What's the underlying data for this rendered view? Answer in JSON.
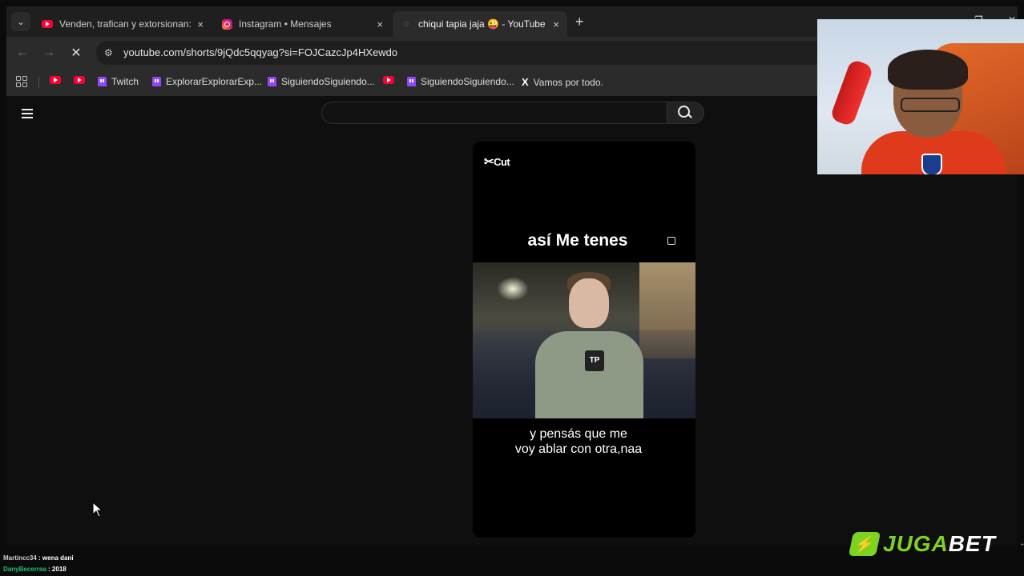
{
  "browser": {
    "tabs": [
      {
        "title": "Venden, trafican y extorsionan:",
        "favicon": "youtube-icon",
        "active": false
      },
      {
        "title": "Instagram • Mensajes",
        "favicon": "instagram-icon",
        "active": false
      },
      {
        "title": "chiqui tapia jaja 😜 - YouTube",
        "favicon": "loading-icon",
        "active": true
      }
    ],
    "new_tab": "+",
    "close_glyph": "×",
    "url": "youtube.com/shorts/9jQdc5qqyag?si=FOJCazcJp4HXewdo",
    "bookmarks": [
      {
        "label": "",
        "icon": "youtube-icon"
      },
      {
        "label": "",
        "icon": "youtube-icon"
      },
      {
        "label": "Twitch",
        "icon": "twitch-icon"
      },
      {
        "label": "ExplorarExplorarExp...",
        "icon": "twitch-icon"
      },
      {
        "label": "SiguiendoSiguiendo...",
        "icon": "twitch-icon"
      },
      {
        "label": "",
        "icon": "youtube-icon"
      },
      {
        "label": "SiguiendoSiguiendo...",
        "icon": "twitch-icon"
      },
      {
        "label": "Vamos por todo.",
        "icon": "x-icon"
      }
    ]
  },
  "youtube": {
    "search_placeholder": "",
    "short": {
      "watermark": "Cut",
      "caption_top": "así Me tenes",
      "mic_logo": "TP",
      "caption_bottom_line1": "y pensás que me",
      "caption_bottom_line2": "voy ablar con otra,naa"
    }
  },
  "overlay": {
    "sponsor_part1": "JUGA",
    "sponsor_part2": "BET",
    "chat": [
      {
        "user": "Martincc34",
        "message": "wena dani"
      },
      {
        "user": "DanyBecerraa",
        "message": "2018"
      }
    ]
  },
  "colors": {
    "youtube_red": "#ff0033",
    "twitch_purple": "#9146ff",
    "sponsor_green": "#7ed321",
    "chat_user2": "#1ec46d"
  }
}
